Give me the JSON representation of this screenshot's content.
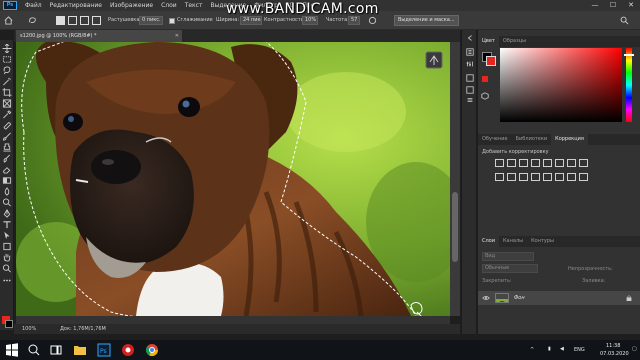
{
  "menu": {
    "app_logo": "Ps",
    "items": [
      "Файл",
      "Редактирование",
      "Изображение",
      "Слои",
      "Текст",
      "Выделение",
      "Фильтр",
      "3D",
      "Про"
    ]
  },
  "watermark": "www.BANDICAM.com",
  "options_bar": {
    "feather_label": "Растушевка:",
    "feather_value": "0 пикс.",
    "antialias_label": "Сглаживание",
    "width_label": "Ширина:",
    "width_value": "24 пикс.",
    "contrast_label": "Контрастность:",
    "contrast_value": "10%",
    "frequency_label": "Частота:",
    "frequency_value": "57",
    "select_mask_button": "Выделение и маска..."
  },
  "document": {
    "tab_title": "s1200.jpg @ 100% (RGB/8#) *",
    "zoom": "100%",
    "doc_size": "Док: 1,76M/1,76M"
  },
  "panels": {
    "color_tabs": [
      "Цвет",
      "Образцы"
    ],
    "adjust_tabs": [
      "Обучение",
      "Библиотеки",
      "Коррекция"
    ],
    "adjust_subtitle": "Добавить корректировку",
    "layers_tabs": [
      "Слои",
      "Каналы",
      "Контуры"
    ],
    "layer_search_placeholder": "Вид",
    "blend_mode": "Обычные",
    "opacity_label": "Непрозрачность:",
    "lock_label": "Закрепить:",
    "fill_label": "Заливка:",
    "layer_name": "Фон"
  },
  "colors": {
    "foreground": "#e8261f",
    "background": "#000000",
    "accent": "#31a8ff"
  },
  "taskbar": {
    "language": "ENG",
    "time": "11:38",
    "date": "07.03.2020"
  },
  "icons": [
    "move-icon",
    "marquee-icon",
    "lasso-icon",
    "magic-wand-icon",
    "crop-icon",
    "eyedropper-icon",
    "healing-icon",
    "brush-icon",
    "stamp-icon",
    "history-brush-icon",
    "eraser-icon",
    "gradient-icon",
    "blur-icon",
    "dodge-icon",
    "pen-icon",
    "type-icon",
    "path-select-icon",
    "shape-icon",
    "hand-icon",
    "zoom-icon"
  ]
}
